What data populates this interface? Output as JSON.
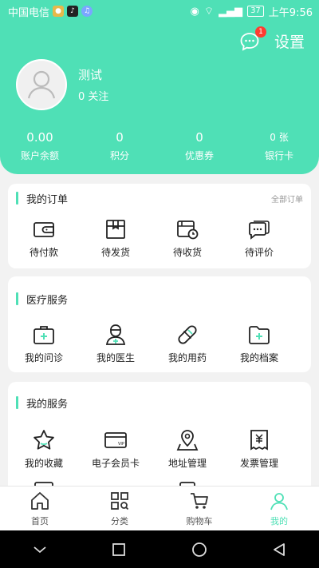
{
  "status_bar": {
    "carrier": "中国电信",
    "battery": "37",
    "time": "上午9:56"
  },
  "header": {
    "message_badge": "1",
    "settings_label": "设置",
    "user": {
      "name": "测试",
      "follow": "0 关注"
    },
    "stats": [
      {
        "value": "0.00",
        "label": "账户余额"
      },
      {
        "value": "0",
        "label": "积分"
      },
      {
        "value": "0",
        "label": "优惠券"
      },
      {
        "value": "0 张",
        "label": "银行卡"
      }
    ]
  },
  "orders": {
    "title": "我的订单",
    "all_link": "全部订单",
    "items": [
      {
        "label": "待付款",
        "icon": "wallet-icon"
      },
      {
        "label": "待发货",
        "icon": "box-icon"
      },
      {
        "label": "待收货",
        "icon": "delivery-clock-icon"
      },
      {
        "label": "待评价",
        "icon": "comment-icon"
      }
    ]
  },
  "medical": {
    "title": "医疗服务",
    "items": [
      {
        "label": "我的问诊",
        "icon": "medical-kit-icon"
      },
      {
        "label": "我的医生",
        "icon": "doctor-icon"
      },
      {
        "label": "我的用药",
        "icon": "pill-icon"
      },
      {
        "label": "我的档案",
        "icon": "folder-icon"
      }
    ]
  },
  "services": {
    "title": "我的服务",
    "items": [
      {
        "label": "我的收藏",
        "icon": "star-icon"
      },
      {
        "label": "电子会员卡",
        "icon": "vip-card-icon"
      },
      {
        "label": "地址管理",
        "icon": "map-pin-icon"
      },
      {
        "label": "发票管理",
        "icon": "invoice-icon"
      }
    ]
  },
  "tabbar": {
    "items": [
      {
        "label": "首页",
        "icon": "home-icon"
      },
      {
        "label": "分类",
        "icon": "category-icon"
      },
      {
        "label": "购物车",
        "icon": "cart-icon"
      },
      {
        "label": "我的",
        "icon": "user-icon"
      }
    ]
  },
  "colors": {
    "accent": "#4fe0b6",
    "badge": "#ff3b30"
  }
}
